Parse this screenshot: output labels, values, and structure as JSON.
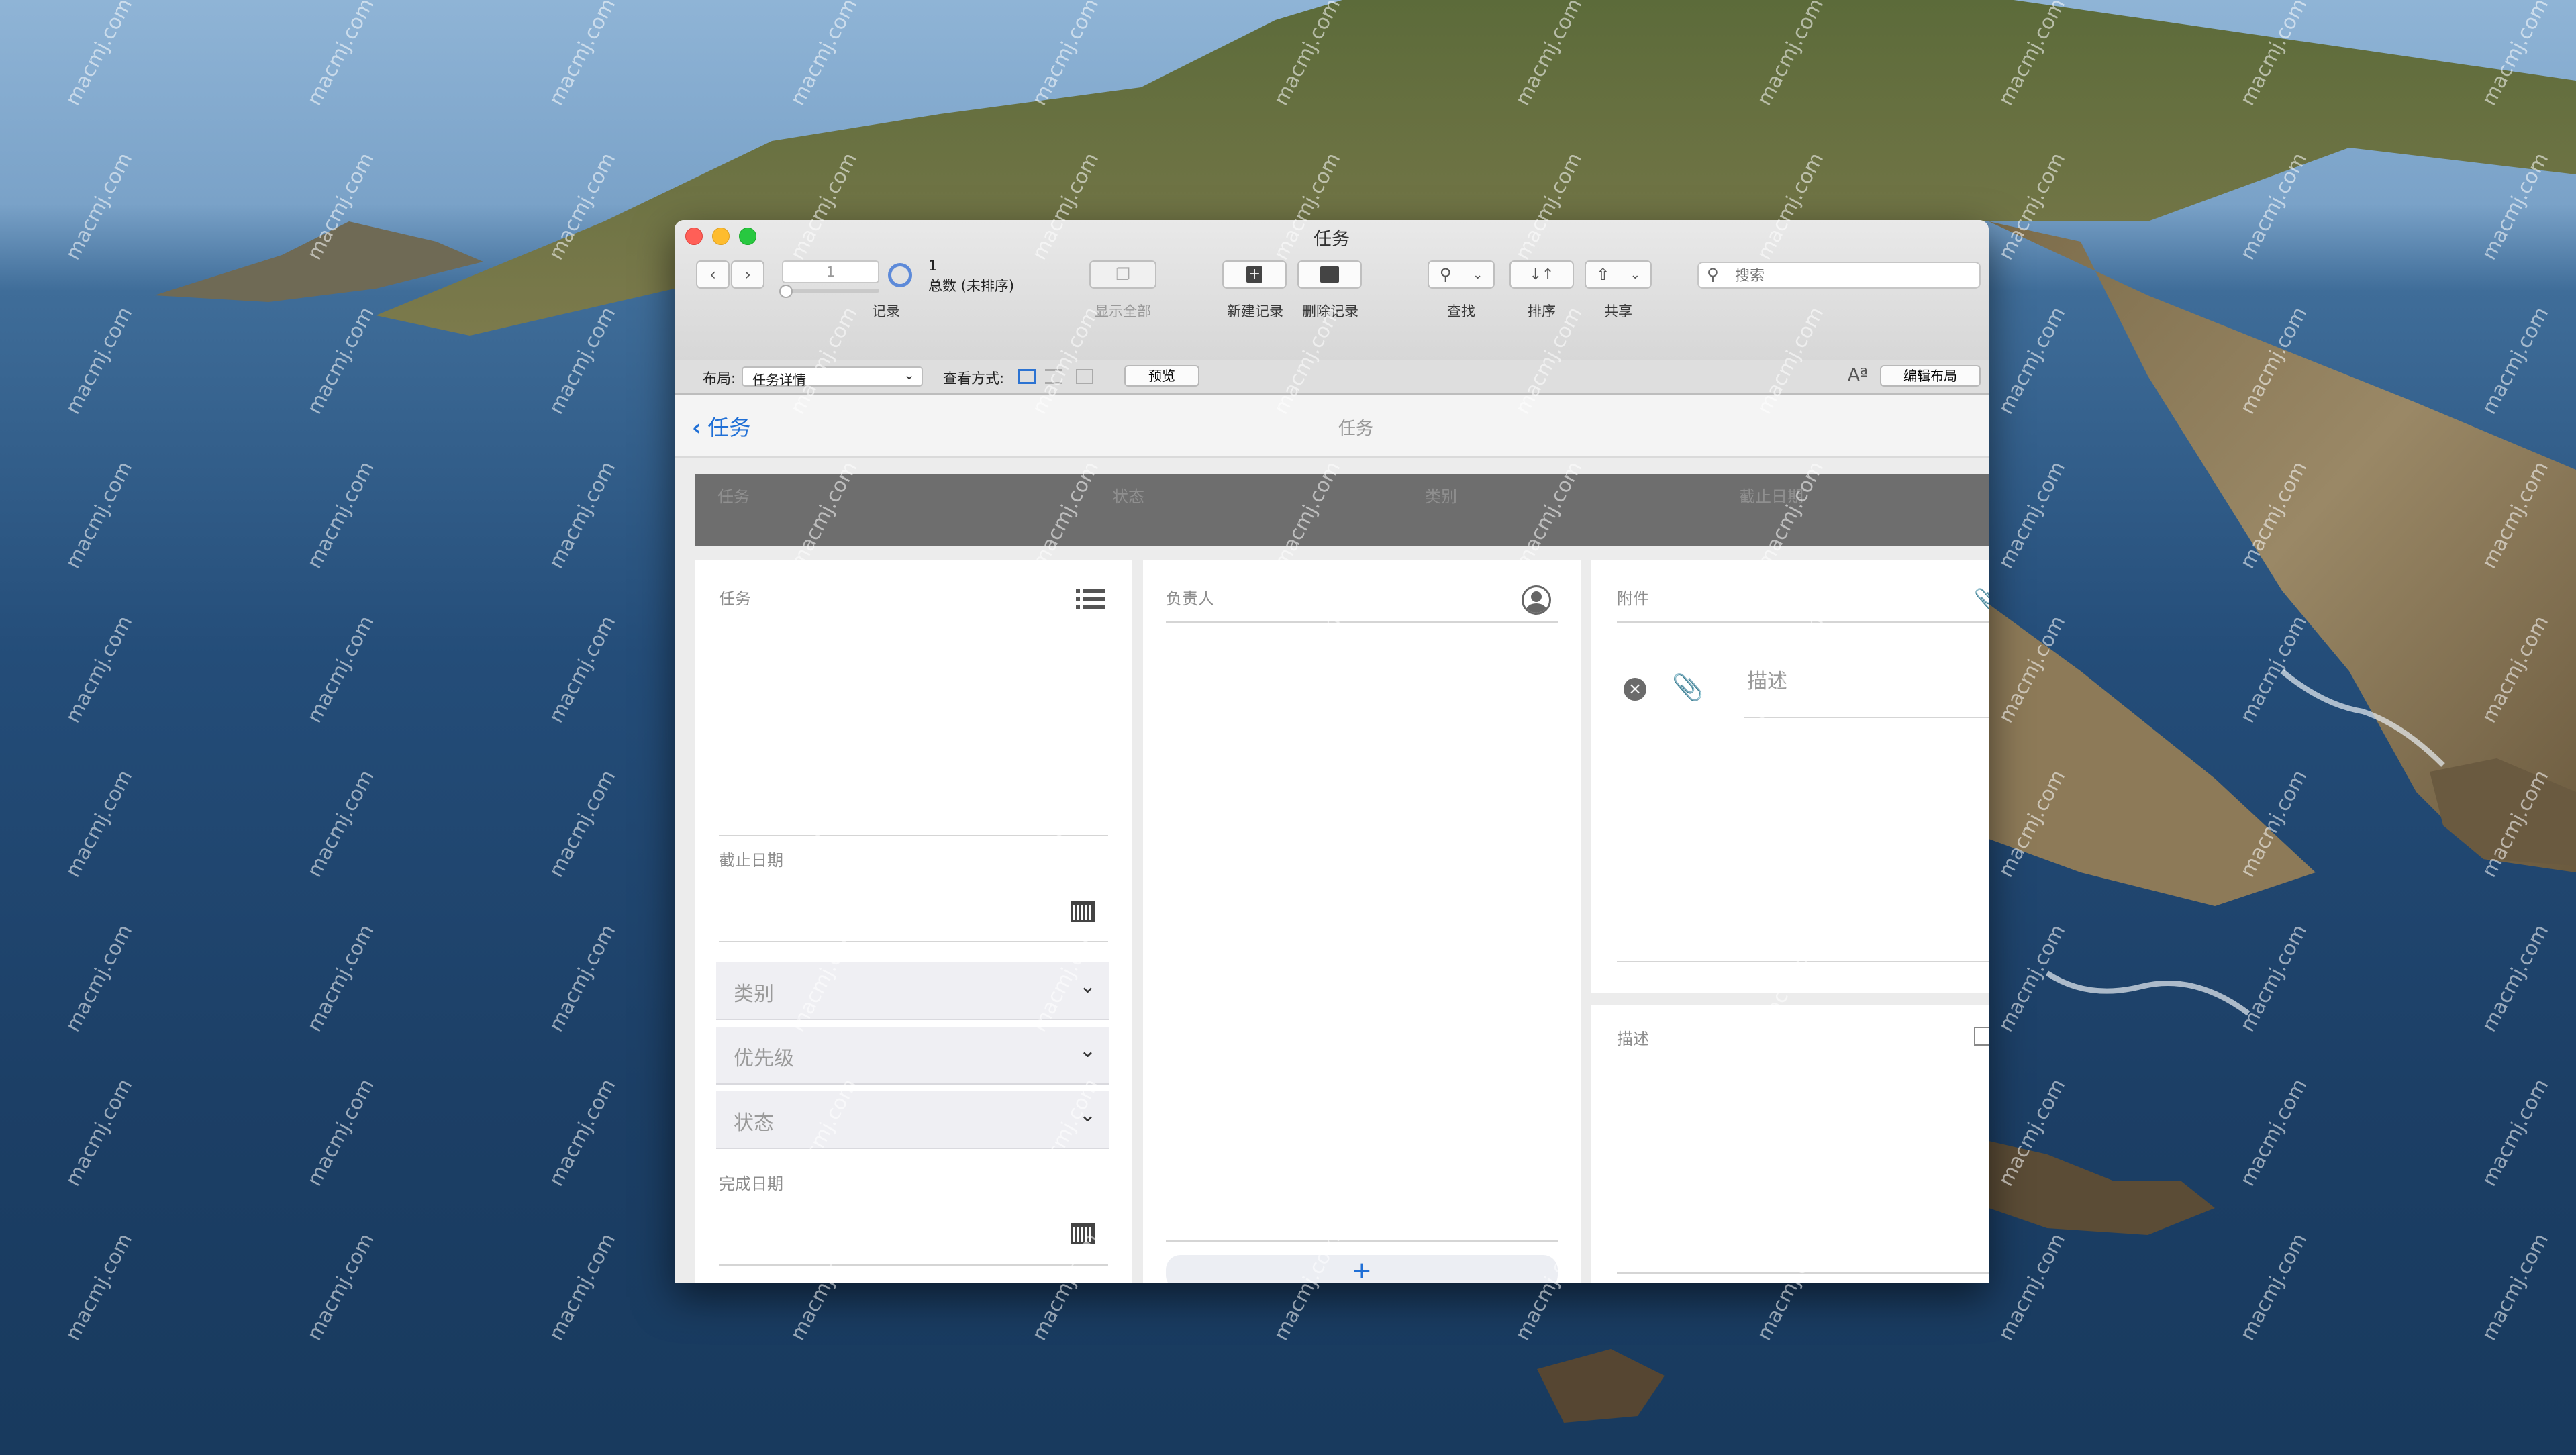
{
  "window": {
    "title": "任务"
  },
  "toolbar": {
    "record_value": "1",
    "count_number": "1",
    "count_text": "总数 (未排序)",
    "records_label": "记录",
    "show_all_label": "显示全部",
    "new_record_label": "新建记录",
    "delete_record_label": "删除记录",
    "find_label": "查找",
    "sort_label": "排序",
    "share_label": "共享",
    "search_placeholder": "搜索"
  },
  "layoutbar": {
    "layout_label": "布局:",
    "layout_value": "任务详情",
    "view_label": "查看方式:",
    "preview_label": "预览",
    "font_icon_text": "Aª",
    "edit_layout_label": "编辑布局"
  },
  "nav": {
    "back_label": "任务",
    "center_title": "任务"
  },
  "columns": [
    "任务",
    "状态",
    "类别",
    "截止日期"
  ],
  "form": {
    "task_label": "任务",
    "due_date_label": "截止日期",
    "category_label": "类别",
    "priority_label": "优先级",
    "status_label": "状态",
    "completed_date_label": "完成日期",
    "assignee_label": "负责人",
    "add_symbol": "+",
    "attachment_label": "附件",
    "attachment_desc_label": "描述",
    "description_label": "描述"
  },
  "watermark": "macmj.com",
  "colors": {
    "accent": "#1f6fd6",
    "column_bar": "#6e6e6e"
  }
}
